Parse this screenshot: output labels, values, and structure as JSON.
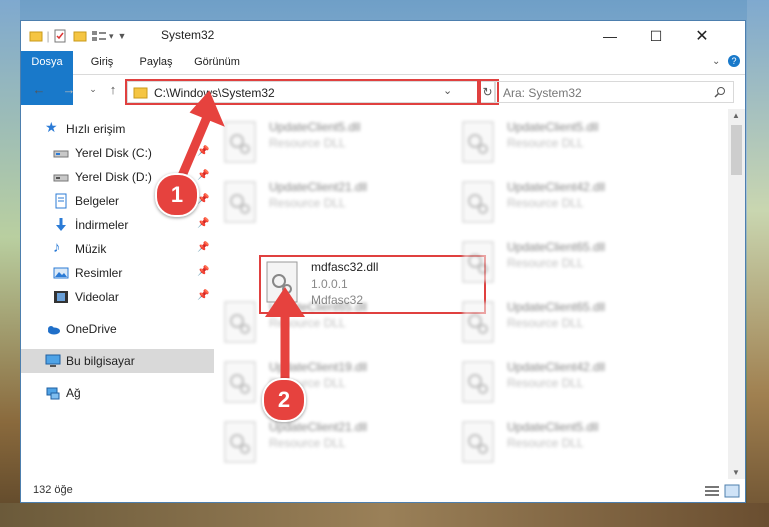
{
  "window": {
    "title": "System32"
  },
  "ribbon": {
    "tabs": [
      "Dosya",
      "Giriş",
      "Paylaş",
      "Görünüm"
    ]
  },
  "address": {
    "path": "C:\\Windows\\System32"
  },
  "search": {
    "placeholder": "Ara: System32"
  },
  "sidebar": {
    "items": [
      {
        "label": "Hızlı erişim",
        "icon": "star-icon"
      },
      {
        "label": "Yerel Disk (C:)",
        "icon": "drive-icon"
      },
      {
        "label": "Yerel Disk (D:)",
        "icon": "drive-icon"
      },
      {
        "label": "Belgeler",
        "icon": "documents-icon"
      },
      {
        "label": "İndirmeler",
        "icon": "downloads-icon"
      },
      {
        "label": "Müzik",
        "icon": "music-icon"
      },
      {
        "label": "Resimler",
        "icon": "pictures-icon"
      },
      {
        "label": "Videolar",
        "icon": "videos-icon"
      },
      {
        "label": "OneDrive",
        "icon": "cloud-icon"
      },
      {
        "label": "Bu bilgisayar",
        "icon": "computer-icon"
      },
      {
        "label": "Ağ",
        "icon": "network-icon"
      }
    ]
  },
  "files": [
    {
      "name": "UpdateClient5.dll",
      "line1": "Resource DLL",
      "line2": ""
    },
    {
      "name": "UpdateClient5.dll",
      "line1": "Resource DLL",
      "line2": ""
    },
    {
      "name": "UpdateClient21.dll",
      "line1": "Resource DLL",
      "line2": ""
    },
    {
      "name": "UpdateClient42.dll",
      "line1": "Resource DLL",
      "line2": ""
    },
    {
      "name": "mdfasc32.dll",
      "line1": "1.0.0.1",
      "line2": "Mdfasc32"
    },
    {
      "name": "UpdateClient65.dll",
      "line1": "Resource DLL",
      "line2": ""
    },
    {
      "name": "UpdateClient65.dll",
      "line1": "Resource DLL",
      "line2": ""
    },
    {
      "name": "UpdateClient65.dll",
      "line1": "Resource DLL",
      "line2": ""
    },
    {
      "name": "UpdateClient19.dll",
      "line1": "Resource DLL",
      "line2": ""
    },
    {
      "name": "UpdateClient42.dll",
      "line1": "Resource DLL",
      "line2": ""
    },
    {
      "name": "UpdateClient21.dll",
      "line1": "Resource DLL",
      "line2": ""
    },
    {
      "name": "UpdateClient5.dll",
      "line1": "Resource DLL",
      "line2": ""
    }
  ],
  "status": {
    "item_count": "132 öğe"
  },
  "callouts": {
    "step1": "1",
    "step2": "2"
  },
  "colors": {
    "accent": "#1979ca",
    "highlight": "#e0403f"
  }
}
